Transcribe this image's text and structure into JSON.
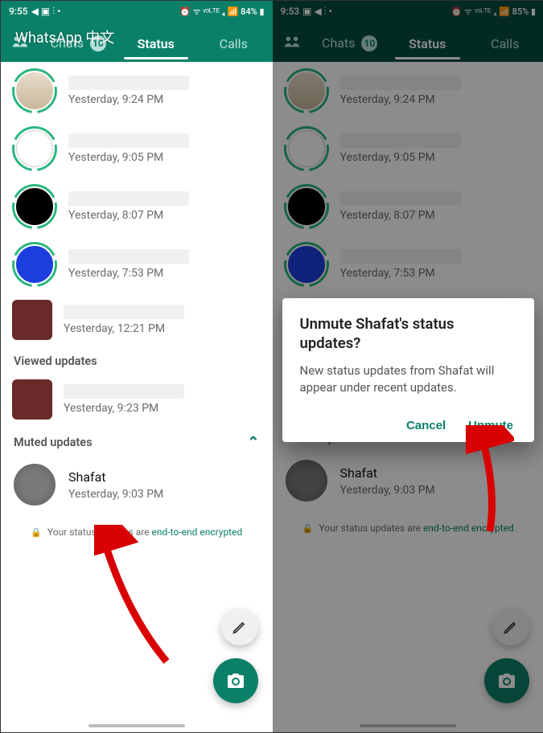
{
  "left": {
    "statusbar": {
      "time": "9:55",
      "icons": "◀ ▣ ⫶ •",
      "right": "⏰ ᯤ ᵛᵒᴸᵀᴱ ₄ 📶 84% ▮"
    },
    "overlay_title": "WhatsApp 中文",
    "tabs": {
      "chats": "Chats",
      "chats_badge": "10",
      "status": "Status",
      "calls": "Calls"
    },
    "recent": [
      {
        "time": "Yesterday, 9:24 PM",
        "avatar": "av-bag",
        "ring": "ring-unseen"
      },
      {
        "time": "Yesterday, 9:05 PM",
        "avatar": "av-text",
        "ring": "ring-unseen"
      },
      {
        "time": "Yesterday, 8:07 PM",
        "avatar": "av-black",
        "ring": "ring-unseen"
      },
      {
        "time": "Yesterday, 7:53 PM",
        "avatar": "av-blue",
        "ring": "ring-unseen"
      },
      {
        "time": "Yesterday, 12:21 PM",
        "avatar": "av-maroon",
        "ring": "ring-unseen",
        "square": true
      }
    ],
    "viewed_header": "Viewed updates",
    "viewed": [
      {
        "time": "Yesterday, 9:23 PM",
        "avatar": "av-maroon"
      }
    ],
    "muted_header": "Muted updates",
    "muted": [
      {
        "name": "Shafat",
        "time": "Yesterday, 9:03 PM",
        "avatar": "av-muted"
      }
    ],
    "encryption_prefix": "Your status updates are ",
    "encryption_link": "end-to-end encrypted"
  },
  "right": {
    "statusbar": {
      "time": "9:53",
      "icons": "▣ ◀ ⫶ •",
      "right": "⏰ ᯤ ᵛᵒᴸᵀᴱ ₄ 📶 85% ▮"
    },
    "dialog": {
      "title": "Unmute Shafat's status updates?",
      "body": "New status updates from Shafat will appear under recent updates.",
      "cancel": "Cancel",
      "confirm": "Unmute"
    }
  }
}
